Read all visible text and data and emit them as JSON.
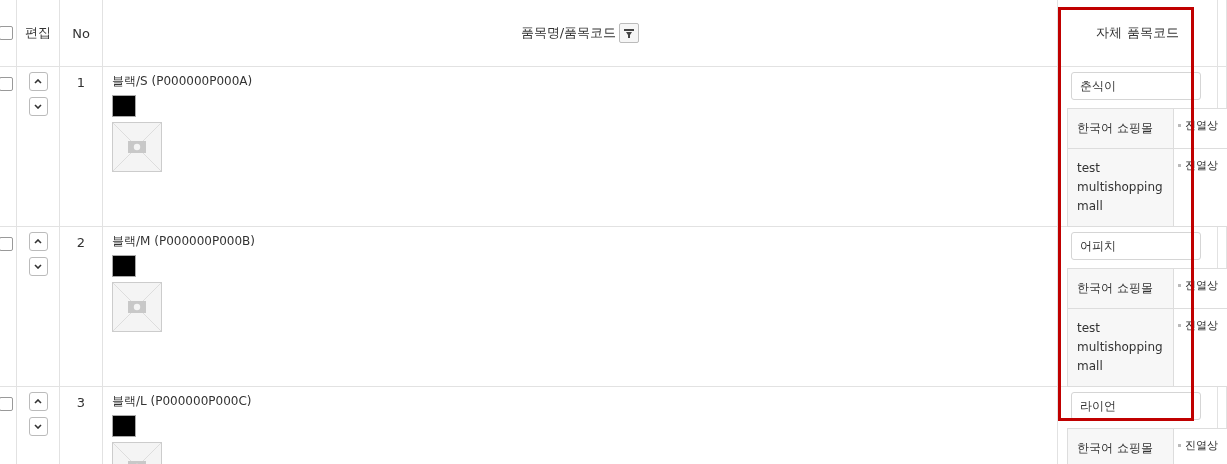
{
  "header": {
    "checked": false,
    "columns": [
      {
        "label": "편집"
      },
      {
        "label": "No"
      },
      {
        "label": "품목명/품목코드",
        "filter": true
      },
      {
        "label": "자체 품목코드",
        "highlighted": true
      }
    ]
  },
  "rows": [
    {
      "checked": false,
      "no": "1",
      "name": "블랙/S (P000000P000A)",
      "color": "#000000",
      "own_code": "춘식이",
      "malls": [
        {
          "name": "한국어 쇼핑몰",
          "status": "진열상"
        },
        {
          "name": "test multishopping mall",
          "status": "진열상"
        }
      ]
    },
    {
      "checked": false,
      "no": "2",
      "name": "블랙/M (P000000P000B)",
      "color": "#000000",
      "own_code": "어피치",
      "malls": [
        {
          "name": "한국어 쇼핑몰",
          "status": "진열상"
        },
        {
          "name": "test multishopping mall",
          "status": "진열상"
        }
      ]
    },
    {
      "checked": false,
      "no": "3",
      "name": "블랙/L (P000000P000C)",
      "color": "#000000",
      "own_code": "라이언",
      "malls": [
        {
          "name": "한국어 쇼핑몰",
          "status": "진열상"
        }
      ]
    }
  ]
}
